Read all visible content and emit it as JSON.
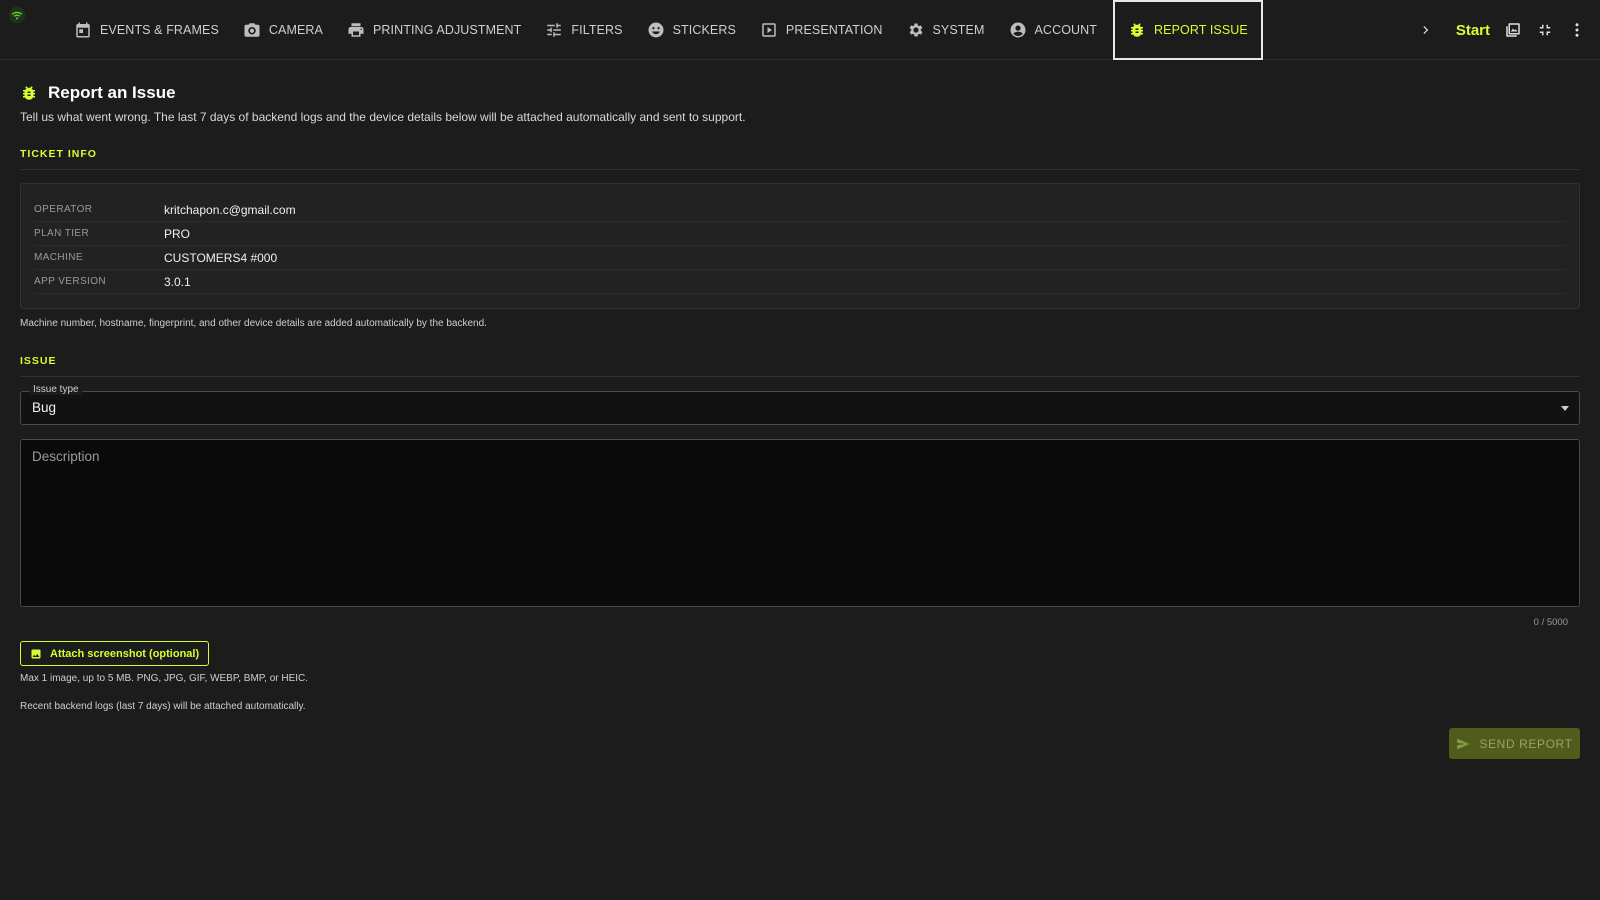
{
  "nav": {
    "tabs": [
      {
        "label": "EVENTS & FRAMES",
        "icon": "calendar-icon"
      },
      {
        "label": "CAMERA",
        "icon": "camera-icon"
      },
      {
        "label": "PRINTING ADJUSTMENT",
        "icon": "printer-icon"
      },
      {
        "label": "FILTERS",
        "icon": "sliders-icon"
      },
      {
        "label": "STICKERS",
        "icon": "smiley-icon"
      },
      {
        "label": "PRESENTATION",
        "icon": "play-box-icon"
      },
      {
        "label": "SYSTEM",
        "icon": "gear-icon"
      },
      {
        "label": "ACCOUNT",
        "icon": "account-circle-icon"
      },
      {
        "label": "REPORT ISSUE",
        "icon": "bug-icon",
        "active": true
      }
    ],
    "start_label": "Start",
    "accent_color": "#d4ff32"
  },
  "page": {
    "title": "Report an Issue",
    "subtitle": "Tell us what went wrong. The last 7 days of backend logs and the device details below will be attached automatically and sent to support."
  },
  "ticket": {
    "section_title": "TICKET INFO",
    "rows": [
      {
        "key": "OPERATOR",
        "value": "kritchapon.c@gmail.com"
      },
      {
        "key": "PLAN TIER",
        "value": "PRO"
      },
      {
        "key": "MACHINE",
        "value": "CUSTOMERS4 #000"
      },
      {
        "key": "APP VERSION",
        "value": "3.0.1"
      }
    ],
    "note": "Machine number, hostname, fingerprint, and other device details are added automatically by the backend."
  },
  "issue": {
    "section_title": "ISSUE",
    "type_label": "Issue type",
    "type_value": "Bug",
    "description_placeholder": "Description",
    "counter": "0 / 5000",
    "attach_label": "Attach screenshot (optional)",
    "attach_hint": "Max 1 image, up to 5 MB. PNG, JPG, GIF, WEBP, BMP, or HEIC.",
    "logs_hint": "Recent backend logs (last 7 days) will be attached automatically.",
    "send_label": "SEND REPORT"
  }
}
